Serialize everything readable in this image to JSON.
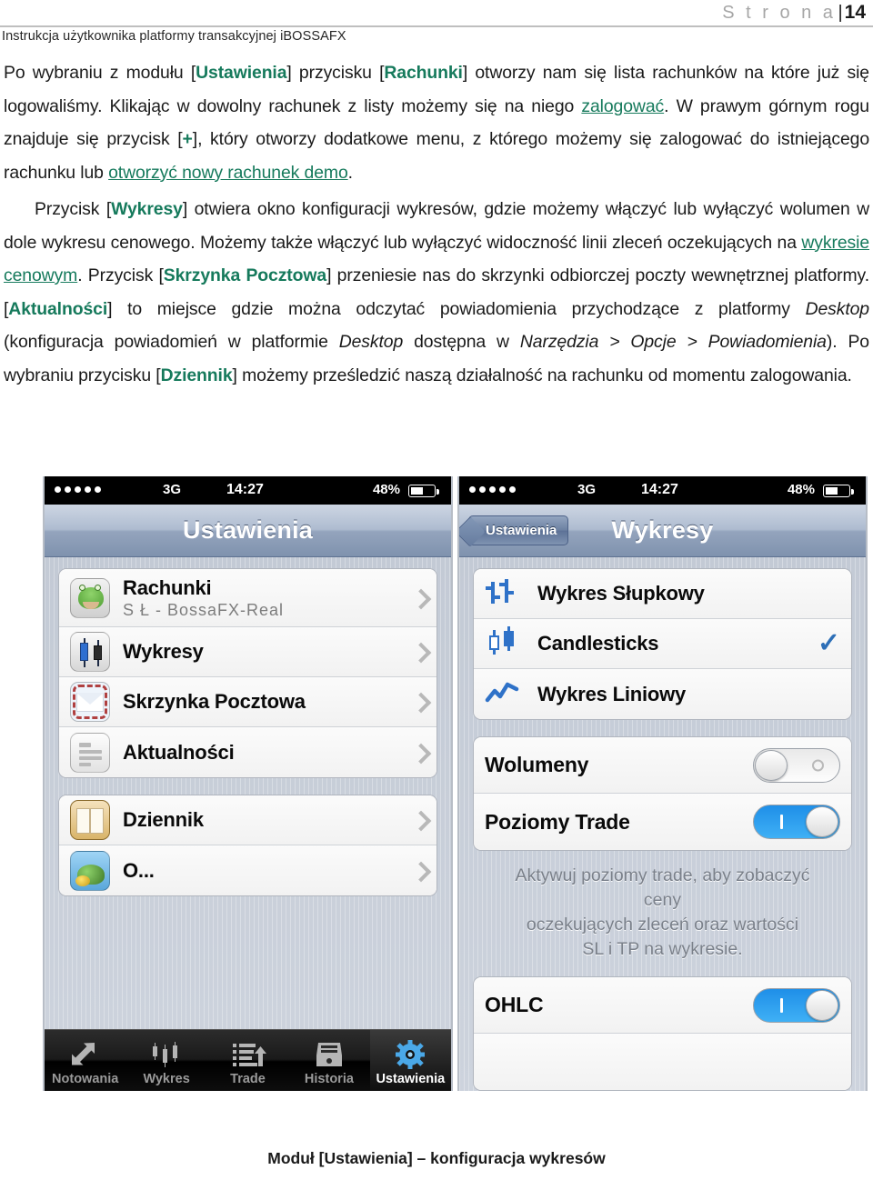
{
  "header": {
    "page_label": "S t r o n a",
    "separator": "|",
    "page_number": "14",
    "subtitle": "Instrukcja użytkownika platformy transakcyjnej iBOSSAFX"
  },
  "paragraphs": {
    "p1": {
      "s1": "Po wybraniu z modułu [",
      "k1": "Ustawienia",
      "s2": "] przycisku [",
      "k2": "Rachunki",
      "s3": "] otworzy nam się lista rachunków na które już się logowaliśmy. Klikając w dowolny rachunek z listy możemy się na niego ",
      "link1": "zalogować",
      "s4": ". W prawym górnym rogu znajduje się przycisk [",
      "k3": "+",
      "s5": "], który otworzy dodatkowe menu, z którego możemy się zalogować do istniejącego rachunku lub ",
      "link2": "otworzyć nowy rachunek demo",
      "s6": "."
    },
    "p2": {
      "s1": "Przycisk [",
      "k1": "Wykresy",
      "s2": "] otwiera okno konfiguracji wykresów, gdzie możemy włączyć lub wyłączyć wolumen w dole wykresu cenowego. Możemy także włączyć lub wyłączyć widoczność linii zleceń oczekujących na ",
      "link1": "wykresie cenowym",
      "s3": ". Przycisk [",
      "k2": "Skrzynka Pocztowa",
      "s4": "] przeniesie nas do skrzynki odbiorczej poczty wewnętrznej platformy. [",
      "k3": "Aktualności",
      "s5": "] to miejsce gdzie można odczytać powiadomienia przychodzące z platformy ",
      "i1": "Desktop",
      "s6": " (konfiguracja powiadomień w platformie ",
      "i2": "Desktop",
      "s7": " dostępna w ",
      "i3": "Narzędzia > Opcje > Powiadomienia",
      "s8": "). Po wybraniu przycisku [",
      "k4": "Dziennik",
      "s9": "] możemy prześledzić naszą działalność na rachunku od momentu zalogowania."
    }
  },
  "colors": {
    "accent_green": "#167a5c",
    "ios_blue": "#2f72c8",
    "switch_on": "#1f8fe8"
  },
  "phone_left": {
    "status": {
      "carrier": "3G",
      "time": "14:27",
      "battery": "48%"
    },
    "nav_title": "Ustawienia",
    "group1": [
      {
        "title": "Rachunki",
        "subtitle": "S      Ł        - BossaFX-Real",
        "icon": "frog-account-icon"
      },
      {
        "title": "Wykresy",
        "subtitle": "",
        "icon": "candlestick-chart-icon"
      },
      {
        "title": "Skrzynka Pocztowa",
        "subtitle": "",
        "icon": "mail-envelope-icon"
      },
      {
        "title": "Aktualności",
        "subtitle": "",
        "icon": "news-list-icon"
      }
    ],
    "group2": [
      {
        "title": "Dziennik",
        "subtitle": "",
        "icon": "journal-book-icon"
      },
      {
        "title": "O...",
        "subtitle": "",
        "icon": "about-globe-icon"
      }
    ],
    "tabs": [
      {
        "label": "Notowania",
        "icon": "arrows-quotes-icon",
        "active": false
      },
      {
        "label": "Wykres",
        "icon": "candles-icon",
        "active": false
      },
      {
        "label": "Trade",
        "icon": "trade-list-icon",
        "active": false
      },
      {
        "label": "Historia",
        "icon": "history-tray-icon",
        "active": false
      },
      {
        "label": "Ustawienia",
        "icon": "gear-icon",
        "active": true
      }
    ]
  },
  "phone_right": {
    "status": {
      "carrier": "3G",
      "time": "14:27",
      "battery": "48%"
    },
    "back_label": "Ustawienia",
    "nav_title": "Wykresy",
    "chart_types": [
      {
        "label": "Wykres Słupkowy",
        "icon": "bar-chart-icon",
        "selected": false
      },
      {
        "label": "Candlesticks",
        "icon": "candlestick-icon",
        "selected": true
      },
      {
        "label": "Wykres Liniowy",
        "icon": "line-chart-icon",
        "selected": false
      }
    ],
    "selected_mark": "✓",
    "switches": [
      {
        "label": "Wolumeny",
        "state": "off"
      },
      {
        "label": "Poziomy Trade",
        "state": "on"
      }
    ],
    "note": "Aktywuj poziomy trade, aby zobaczyć ceny\noczekujących zleceń oraz wartości\nSL i TP na wykresie.",
    "note_lines": [
      "Aktywuj poziomy trade, aby zobaczyć",
      "ceny",
      "oczekujących zleceń oraz wartości",
      "SL i TP na wykresie."
    ],
    "switches2": [
      {
        "label": "OHLC",
        "state": "on"
      }
    ]
  },
  "caption": "Moduł [Ustawienia] – konfiguracja wykresów"
}
